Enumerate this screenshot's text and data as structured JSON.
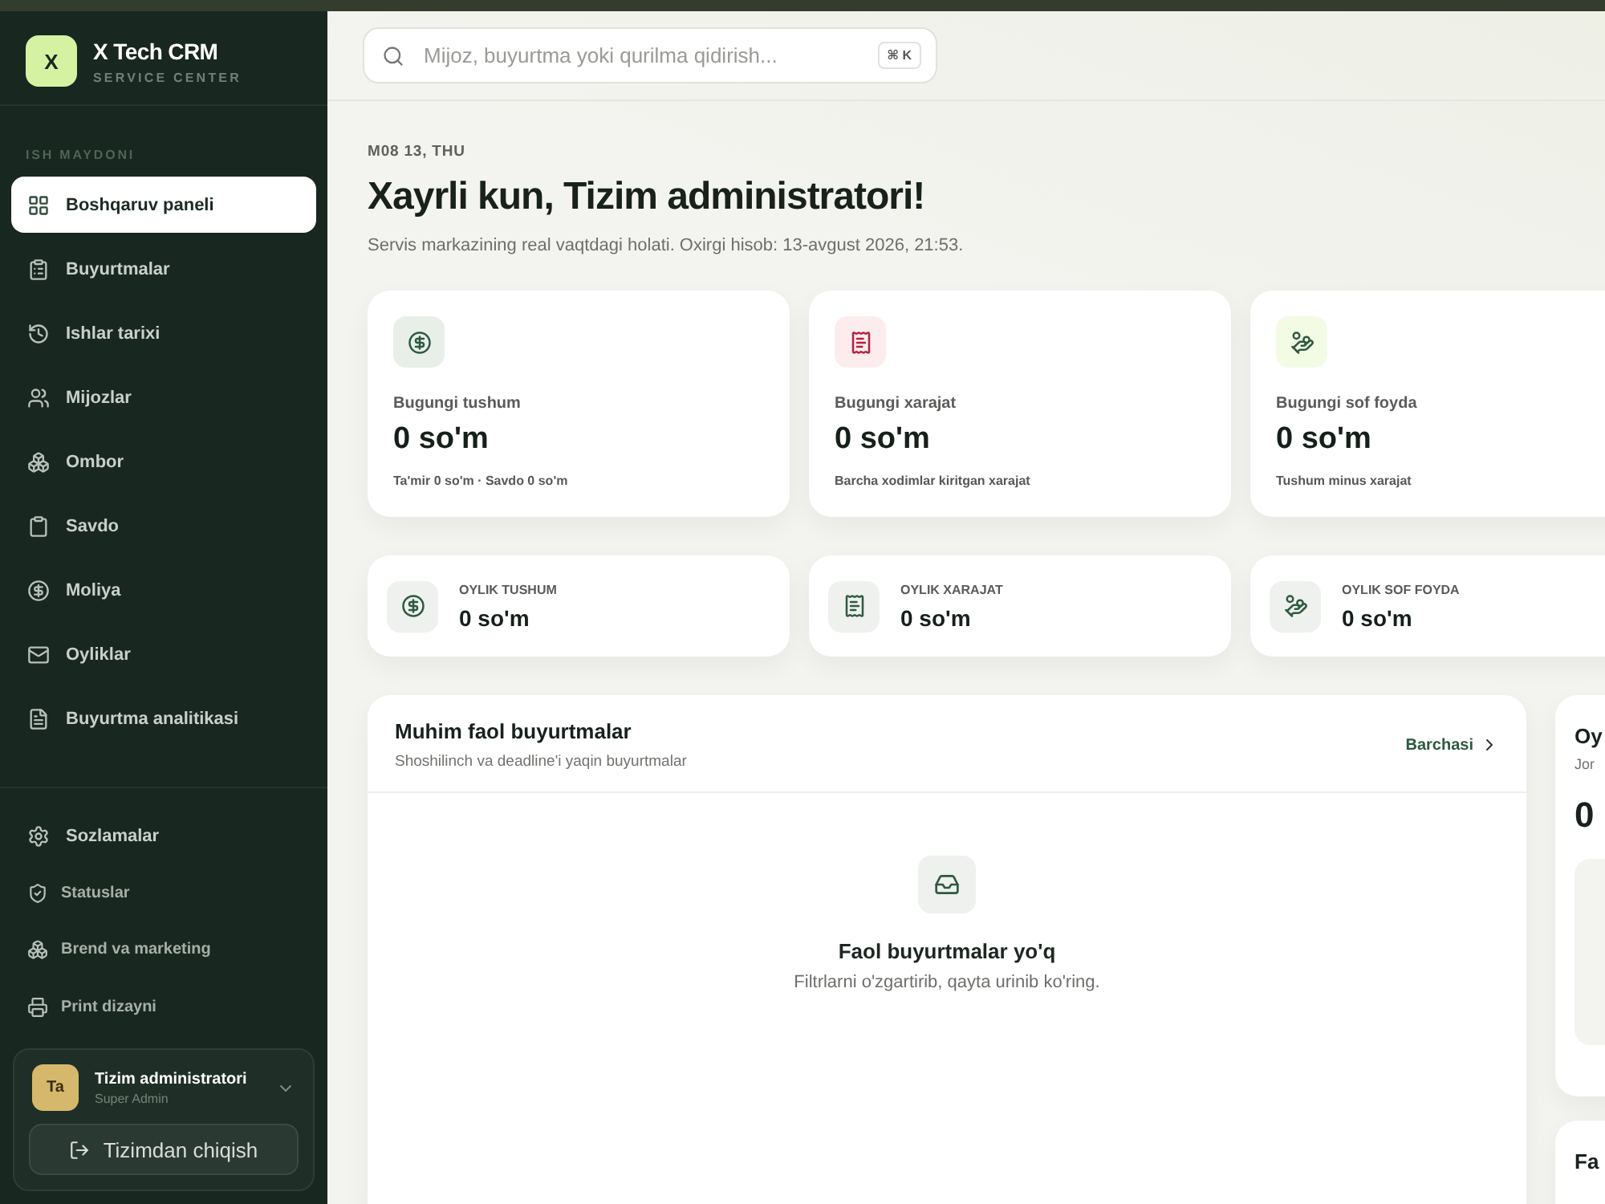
{
  "sidebar": {
    "brand": {
      "logo": "X",
      "name": "X Tech CRM",
      "tagline": "SERVICE CENTER"
    },
    "section_label": "ISH MAYDONI",
    "items": [
      {
        "label": "Boshqaruv paneli",
        "selected": true
      },
      {
        "label": "Buyurtmalar",
        "selected": false
      },
      {
        "label": "Ishlar tarixi",
        "selected": false
      },
      {
        "label": "Mijozlar",
        "selected": false
      },
      {
        "label": "Ombor",
        "selected": false
      },
      {
        "label": "Savdo",
        "selected": false
      },
      {
        "label": "Moliya",
        "selected": false
      },
      {
        "label": "Oyliklar",
        "selected": false
      },
      {
        "label": "Buyurtma analitikasi",
        "selected": false
      }
    ],
    "settings_items": [
      {
        "label": "Sozlamalar",
        "kind": "main"
      },
      {
        "label": "Statuslar",
        "kind": "sub"
      },
      {
        "label": "Brend va marketing",
        "kind": "sub"
      },
      {
        "label": "Print dizayni",
        "kind": "sub"
      }
    ],
    "user": {
      "initials": "Ta",
      "name": "Tizim administratori",
      "role": "Super Admin"
    },
    "logout_button": "Tizimdan chiqish"
  },
  "search": {
    "placeholder": "Mijoz, buyurtma yoki qurilma qidirish...",
    "shortcut": "⌘ K"
  },
  "header": {
    "date": "M08 13, THU",
    "title": "Xayrli kun, Tizim administratori!",
    "subtitle": "Servis markazining real vaqtdagi holati. Oxirgi hisob: 13-avgust 2026, 21:53."
  },
  "today_cards": [
    {
      "kind": "income",
      "label": "Bugungi tushum",
      "value": "0 so'm",
      "note": "Ta'mir 0 so'm · Savdo 0 so'm"
    },
    {
      "kind": "expense",
      "label": "Bugungi xarajat",
      "value": "0 so'm",
      "note": "Barcha xodimlar kiritgan xarajat"
    },
    {
      "kind": "profit",
      "label": "Bugungi sof foyda",
      "value": "0 so'm",
      "note": "Tushum minus xarajat"
    }
  ],
  "monthly_cards": [
    {
      "kind": "income",
      "label": "OYLIK TUSHUM",
      "value": "0 so'm"
    },
    {
      "kind": "expense",
      "label": "OYLIK XARAJAT",
      "value": "0 so'm"
    },
    {
      "kind": "profit",
      "label": "OYLIK SOF FOYDA",
      "value": "0 so'm"
    }
  ],
  "orders_panel": {
    "title": "Muhim faol buyurtmalar",
    "subtitle": "Shoshilinch va deadline'i yaqin buyurtmalar",
    "link": "Barchasi",
    "empty_title": "Faol buyurtmalar yo'q",
    "empty_text": "Filtrlarni o'zgartirib, qayta urinib ko'ring."
  },
  "side_panels": [
    {
      "title": "Oy",
      "subtitle": "Jor",
      "value": "0"
    },
    {
      "title": "Fa"
    }
  ]
}
